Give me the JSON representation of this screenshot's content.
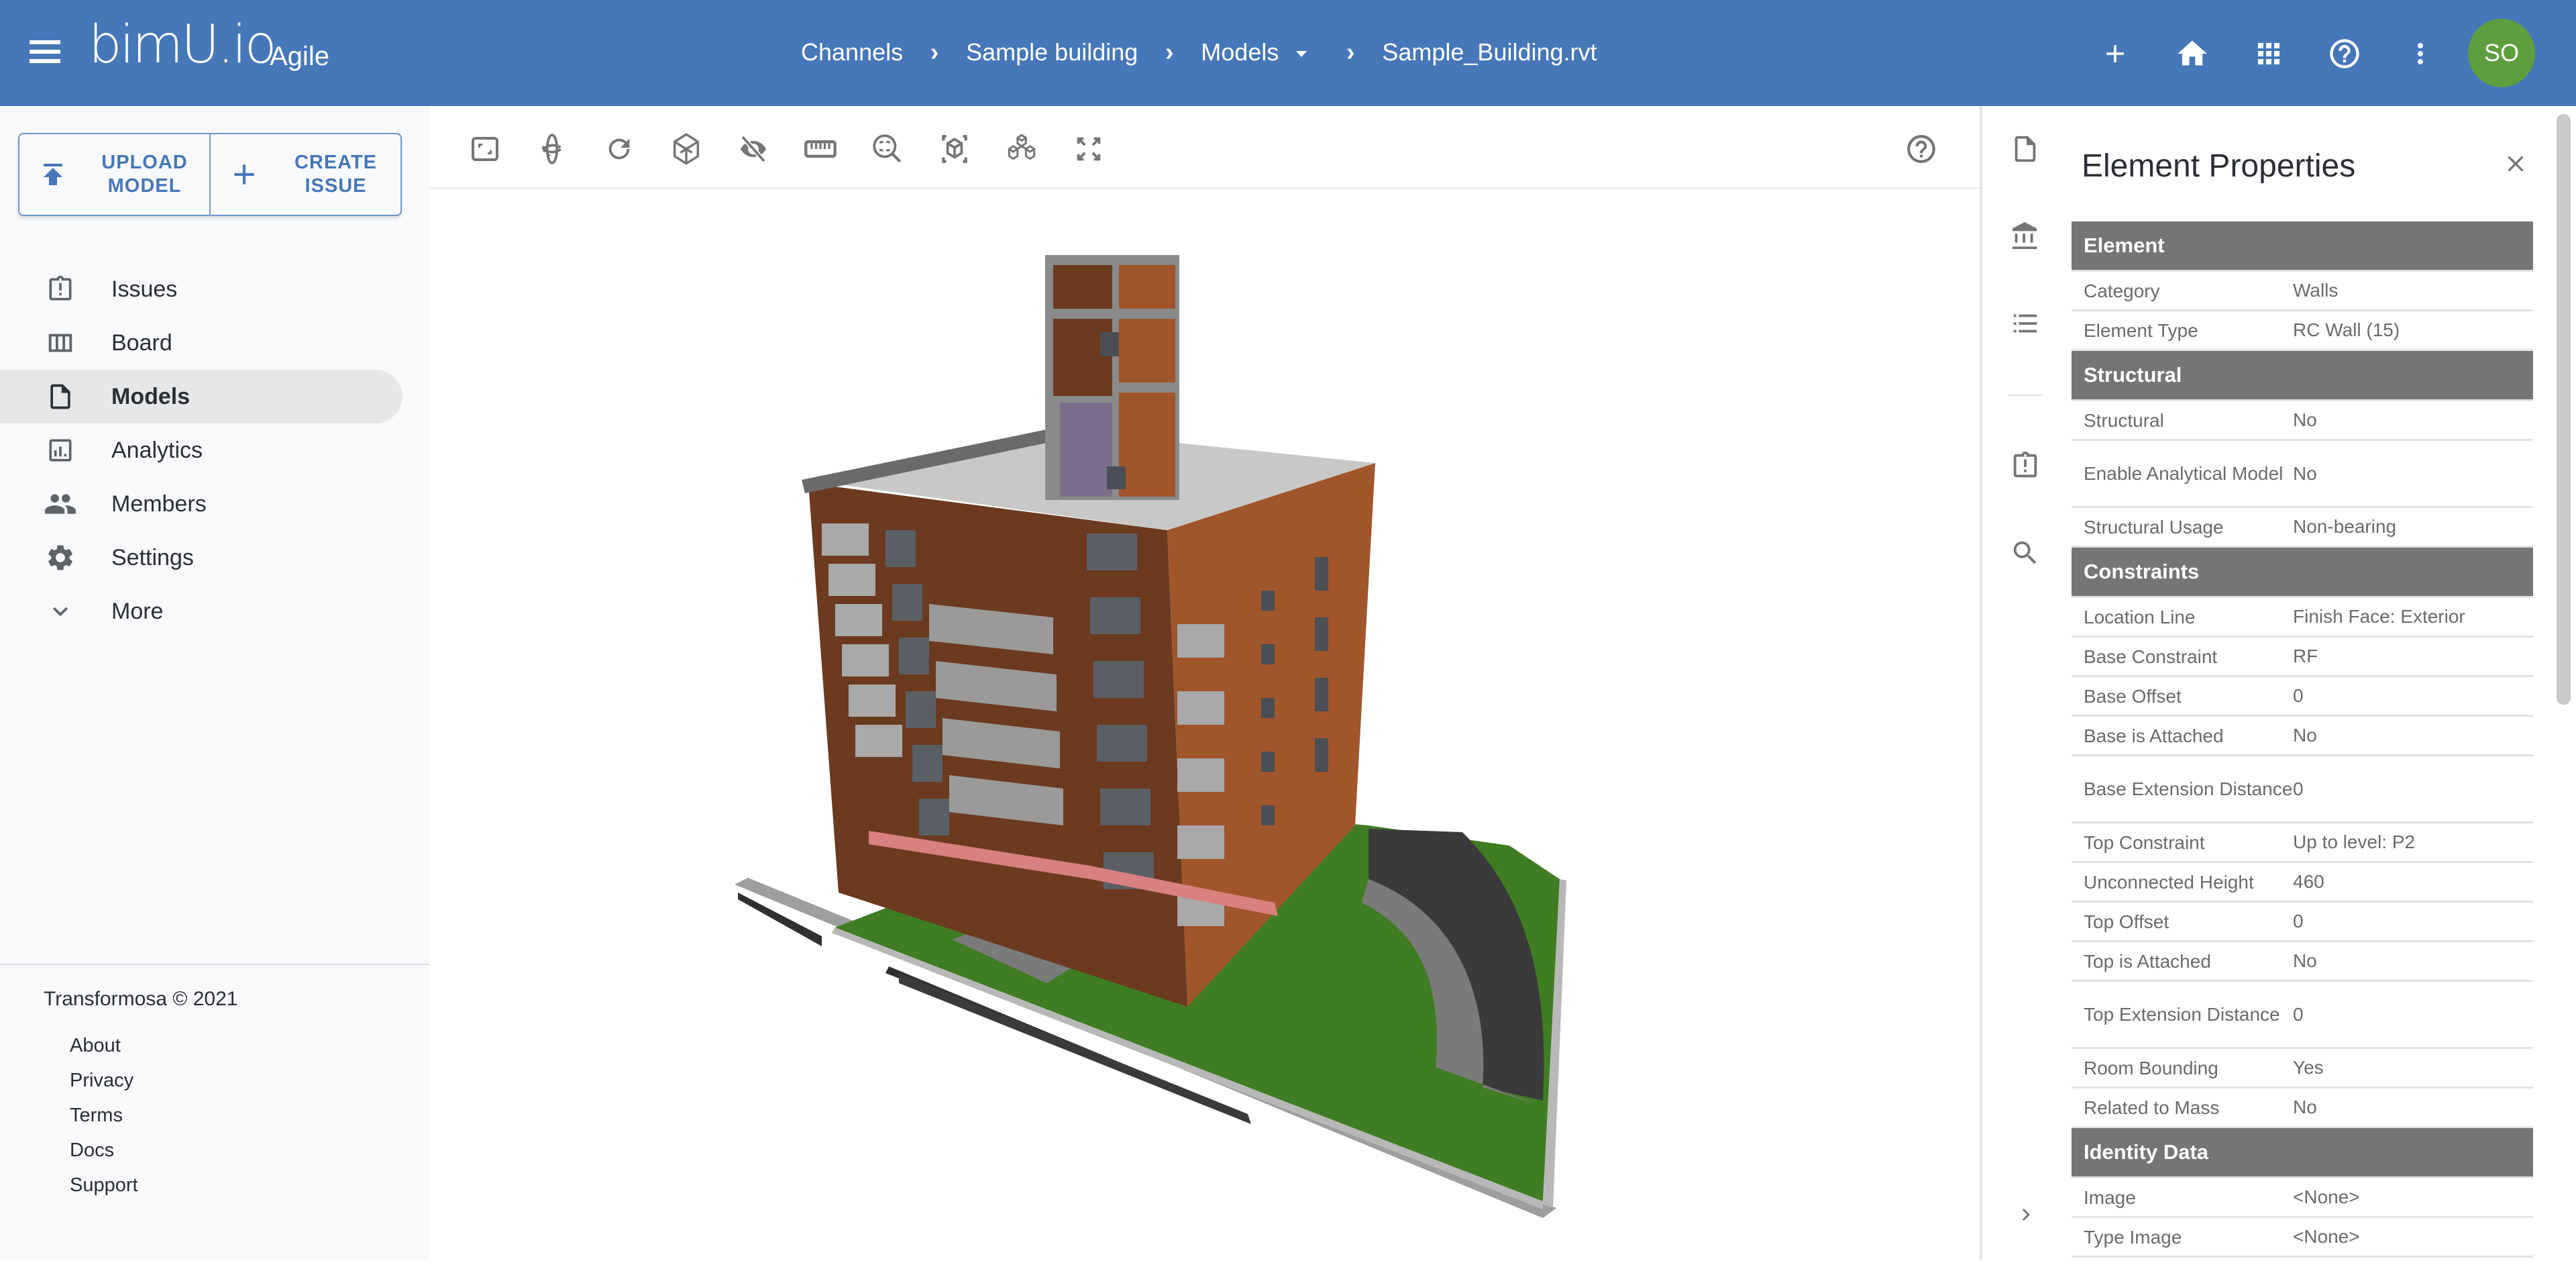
{
  "header": {
    "logo": "bimU.io",
    "product": "Agile",
    "breadcrumb": [
      "Channels",
      "Sample building",
      "Models",
      "Sample_Building.rvt"
    ],
    "avatar_initials": "SO",
    "icons": [
      "menu-icon",
      "plus-icon",
      "home-icon",
      "apps-grid-icon",
      "help-icon",
      "more-vert-icon"
    ]
  },
  "sidebar": {
    "upload_label_1": "UPLOAD",
    "upload_label_2": "MODEL",
    "create_label_1": "CREATE",
    "create_label_2": "ISSUE",
    "items": [
      {
        "label": "Issues",
        "icon": "issue-clipboard-icon",
        "active": false
      },
      {
        "label": "Board",
        "icon": "board-columns-icon",
        "active": false
      },
      {
        "label": "Models",
        "icon": "file-icon",
        "active": true
      },
      {
        "label": "Analytics",
        "icon": "analytics-icon",
        "active": false
      },
      {
        "label": "Members",
        "icon": "people-icon",
        "active": false
      },
      {
        "label": "Settings",
        "icon": "gear-icon",
        "active": false
      },
      {
        "label": "More",
        "icon": "chevron-down-icon",
        "active": false
      }
    ],
    "copyright": "Transformosa © 2021",
    "footer_links": [
      "About",
      "Privacy",
      "Terms",
      "Docs",
      "Support"
    ]
  },
  "viewer": {
    "tools": [
      "fit-view-icon",
      "orbit-icon",
      "rotate-icon",
      "section-box-icon",
      "hide-icon",
      "measure-ruler-icon",
      "zoom-window-icon",
      "isolate-icon",
      "model-tree-icon",
      "fullscreen-icon"
    ],
    "help_icon": "help-icon",
    "colors": {
      "brick_dark": "#6b3a1f",
      "brick_light": "#a0552b",
      "concrete": "#a9a9a9",
      "lawn": "#3f7d23",
      "roof": "#c8c8c8"
    }
  },
  "panel": {
    "title": "Element Properties",
    "strip_icons": [
      "document-icon",
      "bank-icon",
      "list-icon",
      "issue-clipboard-icon",
      "search-icon"
    ],
    "sections": [
      {
        "name": "Element",
        "rows": [
          {
            "k": "Category",
            "v": "Walls"
          },
          {
            "k": "Element Type",
            "v": "RC Wall (15)"
          }
        ]
      },
      {
        "name": "Structural",
        "rows": [
          {
            "k": "Structural",
            "v": "No"
          },
          {
            "k": "Enable Analytical Model",
            "v": "No"
          },
          {
            "k": "Structural Usage",
            "v": "Non-bearing"
          }
        ]
      },
      {
        "name": "Constraints",
        "rows": [
          {
            "k": "Location Line",
            "v": "Finish Face: Exterior"
          },
          {
            "k": "Base Constraint",
            "v": "RF"
          },
          {
            "k": "Base Offset",
            "v": "0"
          },
          {
            "k": "Base is Attached",
            "v": "No"
          },
          {
            "k": "Base Extension Distance",
            "v": "0"
          },
          {
            "k": "Top Constraint",
            "v": "Up to level: P2"
          },
          {
            "k": "Unconnected Height",
            "v": "460"
          },
          {
            "k": "Top Offset",
            "v": "0"
          },
          {
            "k": "Top is Attached",
            "v": "No"
          },
          {
            "k": "Top Extension Distance",
            "v": "0"
          },
          {
            "k": "Room Bounding",
            "v": "Yes"
          },
          {
            "k": "Related to Mass",
            "v": "No"
          }
        ]
      },
      {
        "name": "Identity Data",
        "rows": [
          {
            "k": "Image",
            "v": "<None>"
          },
          {
            "k": "Type Image",
            "v": "<None>"
          }
        ]
      }
    ]
  },
  "colors": {
    "header": "#4677b8",
    "avatar": "#5e9e3e",
    "section_header": "#757575",
    "accent": "#4677b8"
  }
}
